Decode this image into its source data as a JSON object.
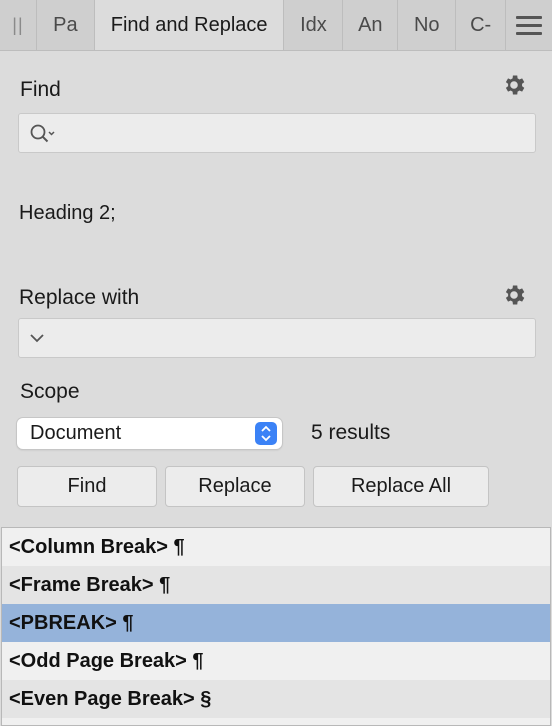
{
  "tabs": [
    {
      "label": "Pa",
      "active": false
    },
    {
      "label": "Find and Replace",
      "active": true
    },
    {
      "label": "Idx",
      "active": false
    },
    {
      "label": "An",
      "active": false
    },
    {
      "label": "No",
      "active": false
    },
    {
      "label": "C-",
      "active": false
    }
  ],
  "find": {
    "label": "Find",
    "value": "",
    "settings_icon": "gear-icon",
    "search_icon": "magnifier-dropdown-icon"
  },
  "find_format_text": "Heading 2;",
  "replace": {
    "label": "Replace with",
    "value": "",
    "settings_icon": "gear-icon"
  },
  "scope": {
    "label": "Scope",
    "selected": "Document",
    "result_count": "5 results"
  },
  "buttons": {
    "find": "Find",
    "replace": "Replace",
    "replace_all": "Replace All"
  },
  "results": [
    {
      "text": "<Column Break> ¶",
      "selected": false
    },
    {
      "text": "<Frame Break> ¶",
      "selected": false
    },
    {
      "text": "<PBREAK> ¶",
      "selected": true
    },
    {
      "text": "<Odd Page Break> ¶",
      "selected": false
    },
    {
      "text": "<Even Page Break> §",
      "selected": false
    }
  ],
  "colors": {
    "panel_bg": "#dcdcdc",
    "selection": "#95b3da",
    "accent": "#3b82f6"
  }
}
